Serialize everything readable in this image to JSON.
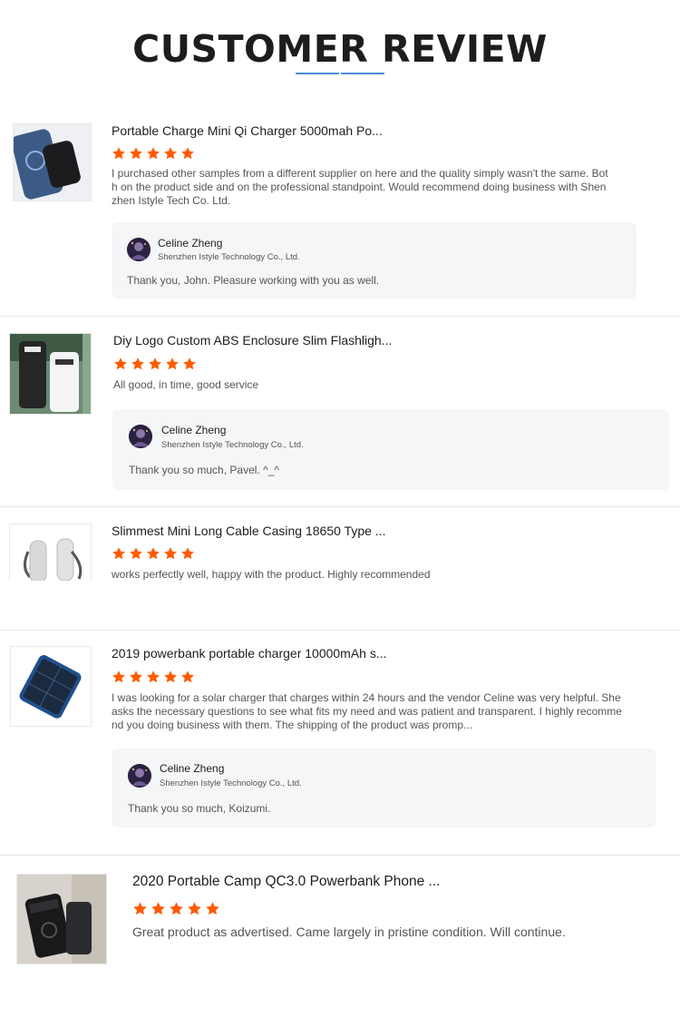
{
  "page": {
    "title": "CUSTOMER REVIEW"
  },
  "colors": {
    "star": "#ff5a00",
    "accent_line": "#4a8fd6",
    "reply_bg": "#f5f6f8"
  },
  "reviews": [
    {
      "product": "Portable Charge Mini Qi Charger 5000mah Po...",
      "rating": 5,
      "text": "I purchased other samples from a different supplier on here and the quality simply wasn't the same. Both on the product side and on the professional standpoint. Would recommend doing business with Shenzhen Istyle Tech Co. Ltd.",
      "reply": {
        "name": "Celine Zheng",
        "company": "Shenzhen Istyle Technology Co., Ltd.",
        "text": "Thank you, John. Pleasure working with you as well."
      }
    },
    {
      "product": "Diy Logo Custom ABS Enclosure Slim Flashligh...",
      "rating": 5,
      "text": "All good, in time, good service",
      "reply": {
        "name": "Celine Zheng",
        "company": "Shenzhen Istyle Technology Co., Ltd.",
        "text": "Thank you so much, Pavel.  ^_^"
      }
    },
    {
      "product": "Slimmest Mini Long Cable Casing 18650 Type ...",
      "rating": 5,
      "text": "works perfectly well, happy with the product. Highly recommended"
    },
    {
      "product": "2019 powerbank portable charger 10000mAh s...",
      "rating": 5,
      "text": "I was looking for a solar charger that charges within 24 hours and the vendor Celine was very helpful. She asks the necessary questions to see what fits my need and was patient and transparent. I highly recommend you doing business with them. The shipping of the product was promp...",
      "reply": {
        "name": "Celine Zheng",
        "company": "Shenzhen Istyle Technology Co., Ltd.",
        "text": "Thank you so much, Koizumi."
      }
    },
    {
      "product": "2020 Portable Camp QC3.0 Powerbank Phone ...",
      "rating": 5,
      "text": "Great product as advertised. Came largely in pristine condition. Will continue."
    }
  ]
}
